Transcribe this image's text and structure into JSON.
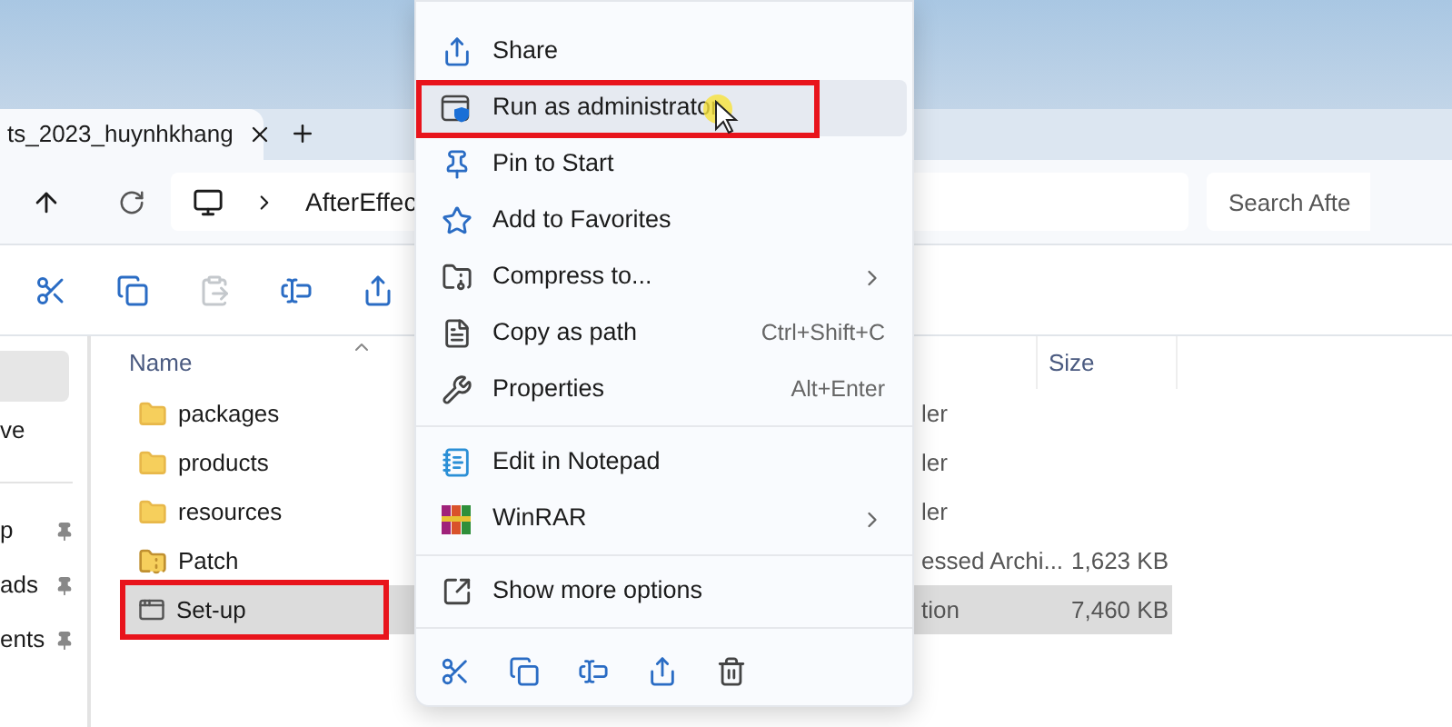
{
  "tabs": [
    {
      "label": "ts_2023_huynhkhang",
      "selected": true
    }
  ],
  "address": {
    "segments": [
      "AfterEffec"
    ]
  },
  "search": {
    "placeholder": "Search Afte"
  },
  "toolbar": [
    {
      "kind": "cut",
      "disabled": false
    },
    {
      "kind": "copy",
      "disabled": false
    },
    {
      "kind": "paste",
      "disabled": true
    },
    {
      "kind": "rename",
      "disabled": false
    },
    {
      "kind": "share",
      "disabled": false
    }
  ],
  "sidebar": {
    "items": [
      {
        "selected": true,
        "pinned": false
      },
      {
        "label": "ve",
        "selected": false,
        "pinned": false
      },
      {
        "kind": "divider"
      },
      {
        "label": "p",
        "selected": false,
        "pinned": true
      },
      {
        "label": "ads",
        "selected": false,
        "pinned": true
      },
      {
        "label": "ents",
        "selected": false,
        "pinned": true
      }
    ]
  },
  "columns": [
    "Name",
    "Size"
  ],
  "rows": [
    {
      "name": "packages",
      "kind": "folder",
      "type": "ler",
      "selected": false,
      "annotated": false
    },
    {
      "name": "products",
      "kind": "folder",
      "type": "ler",
      "selected": false,
      "annotated": false
    },
    {
      "name": "resources",
      "kind": "folder",
      "type": "ler",
      "selected": false,
      "annotated": false
    },
    {
      "name": "Patch",
      "kind": "zip",
      "type": "essed Archi...",
      "size": "1,623 KB",
      "selected": false,
      "annotated": false
    },
    {
      "name": "Set-up",
      "kind": "app",
      "type": "tion",
      "size": "7,460 KB",
      "selected": true,
      "annotated": true
    }
  ],
  "menu": {
    "items": [
      {
        "kind": "share",
        "label": "Share",
        "hovered": false,
        "annotated": false,
        "submenu": false
      },
      {
        "kind": "admin",
        "label": "Run as administrator",
        "hovered": true,
        "annotated": true,
        "submenu": false
      },
      {
        "kind": "pin",
        "label": "Pin to Start",
        "hovered": false,
        "annotated": false,
        "submenu": false
      },
      {
        "kind": "star",
        "label": "Add to Favorites",
        "hovered": false,
        "annotated": false,
        "submenu": false
      },
      {
        "kind": "compress",
        "label": "Compress to...",
        "submenu": true,
        "hovered": false,
        "annotated": false
      },
      {
        "kind": "path",
        "label": "Copy as path",
        "shortcut": "Ctrl+Shift+C",
        "hovered": false,
        "annotated": false,
        "submenu": false
      },
      {
        "kind": "wrench",
        "label": "Properties",
        "shortcut": "Alt+Enter",
        "hovered": false,
        "annotated": false,
        "submenu": false
      },
      {
        "kind": "separator"
      },
      {
        "kind": "notepad",
        "label": "Edit in Notepad",
        "hovered": false,
        "annotated": false,
        "submenu": false
      },
      {
        "kind": "winrar",
        "label": "WinRAR",
        "submenu": true,
        "hovered": false,
        "annotated": false
      },
      {
        "kind": "separator"
      },
      {
        "kind": "more",
        "label": "Show more options",
        "hovered": false,
        "annotated": false,
        "submenu": false
      },
      {
        "kind": "separator"
      }
    ],
    "actions": [
      {
        "kind": "cut"
      },
      {
        "kind": "copy"
      },
      {
        "kind": "rename"
      },
      {
        "kind": "share"
      },
      {
        "kind": "delete"
      }
    ]
  }
}
